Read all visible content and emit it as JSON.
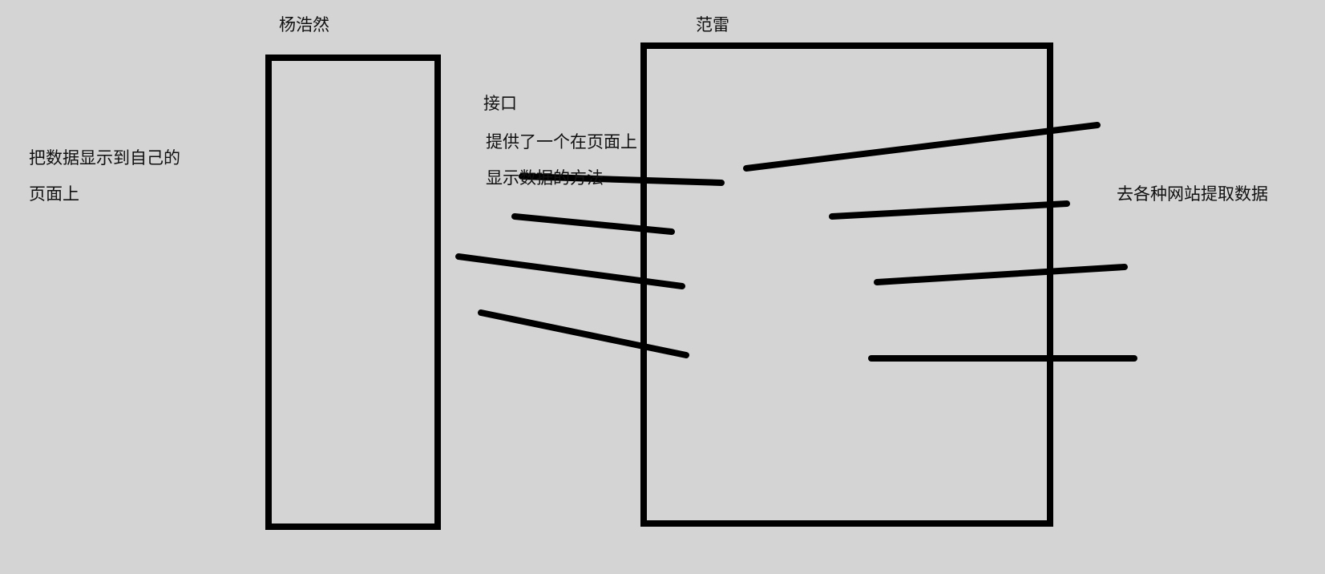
{
  "labels": {
    "left_box_title": "杨浩然",
    "right_box_title": "范雷",
    "interface": "接口",
    "provides_line1": "提供了一个在页面上",
    "provides_line2": "显示数据的方法",
    "display_line1": "把数据显示到自己的",
    "display_line2": "页面上",
    "extract": "去各种网站提取数据"
  },
  "colors": {
    "background": "#d4d4d4",
    "stroke": "#000000",
    "text": "#111111"
  }
}
